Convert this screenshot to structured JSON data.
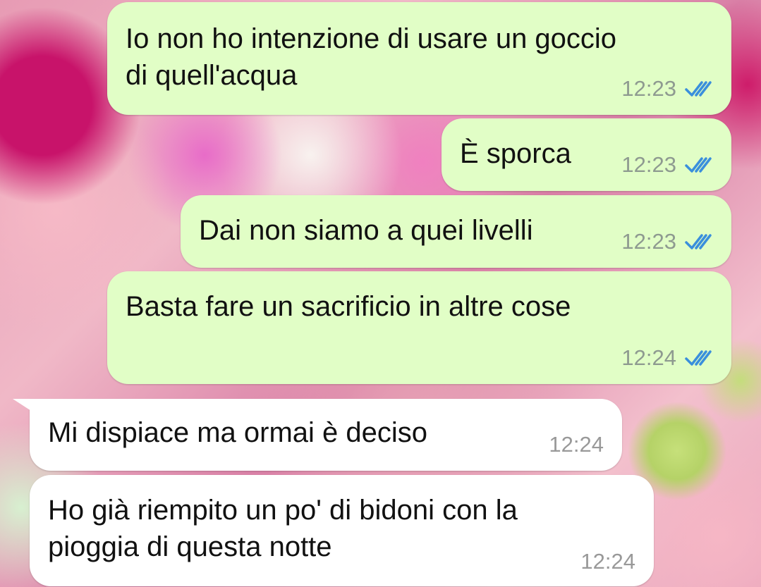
{
  "messages": [
    {
      "direction": "outgoing",
      "text": "Io non ho intenzione di usare un goccio\ndi quell'acqua",
      "time": "12:23",
      "status": "read",
      "icon": "double-check-icon"
    },
    {
      "direction": "outgoing",
      "text": "È sporca",
      "time": "12:23",
      "status": "read",
      "icon": "double-check-icon"
    },
    {
      "direction": "outgoing",
      "text": "Dai non siamo a quei livelli",
      "time": "12:23",
      "status": "read",
      "icon": "double-check-icon"
    },
    {
      "direction": "outgoing",
      "text": "Basta fare un sacrificio in altre cose",
      "time": "12:24",
      "status": "read",
      "icon": "double-check-icon"
    },
    {
      "direction": "incoming",
      "text": "Mi dispiace ma ormai è deciso",
      "time": "12:24"
    },
    {
      "direction": "incoming",
      "text": "Ho già riempito un po' di bidoni con la\npioggia di questa notte",
      "time": "12:24"
    }
  ],
  "colors": {
    "outgoing_bubble": "#e1fec6",
    "incoming_bubble": "#ffffff",
    "read_ticks": "#3a8fdc",
    "timestamp": "#8e9a90"
  },
  "wallpaper": "pink-flowers"
}
